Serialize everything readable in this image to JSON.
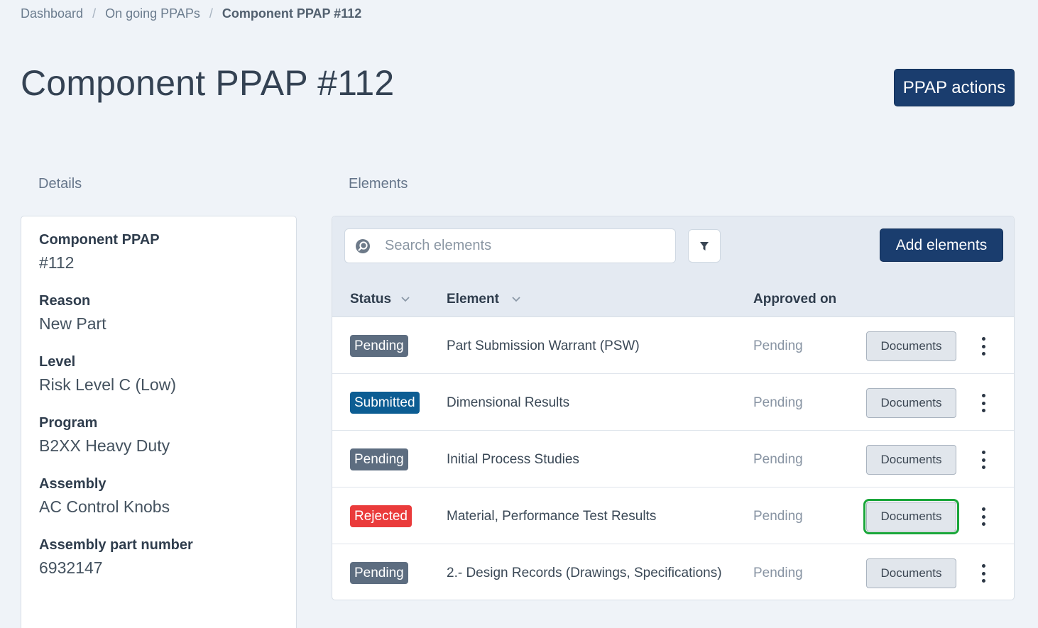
{
  "breadcrumb": {
    "items": [
      "Dashboard",
      "On going PPAPs"
    ],
    "separator": "/",
    "current": "Component PPAP #112"
  },
  "page_title": "Component PPAP #112",
  "actions": {
    "ppap_actions_label": "PPAP actions"
  },
  "details": {
    "heading": "Details",
    "fields": [
      {
        "label": "Component PPAP",
        "value": "#112"
      },
      {
        "label": "Reason",
        "value": "New Part"
      },
      {
        "label": "Level",
        "value": "Risk Level C (Low)"
      },
      {
        "label": "Program",
        "value": "B2XX Heavy Duty"
      },
      {
        "label": "Assembly",
        "value": "AC Control Knobs"
      },
      {
        "label": "Assembly part number",
        "value": "6932147"
      }
    ]
  },
  "elements": {
    "heading": "Elements",
    "search_placeholder": "Search elements",
    "add_label": "Add elements",
    "columns": {
      "status": "Status",
      "element": "Element",
      "approved_on": "Approved on"
    },
    "rows": [
      {
        "status": "Pending",
        "status_kind": "pending",
        "name": "Part Submission Warrant (PSW)",
        "approved_on": "Pending",
        "docs_label": "Documents",
        "highlighted": false
      },
      {
        "status": "Submitted",
        "status_kind": "submitted",
        "name": "Dimensional Results",
        "approved_on": "Pending",
        "docs_label": "Documents",
        "highlighted": false
      },
      {
        "status": "Pending",
        "status_kind": "pending",
        "name": "Initial Process Studies",
        "approved_on": "Pending",
        "docs_label": "Documents",
        "highlighted": false
      },
      {
        "status": "Rejected",
        "status_kind": "rejected",
        "name": "Material, Performance Test Results",
        "approved_on": "Pending",
        "docs_label": "Documents",
        "highlighted": true
      },
      {
        "status": "Pending",
        "status_kind": "pending",
        "name": "2.- Design Records (Drawings, Specifications)",
        "approved_on": "Pending",
        "docs_label": "Documents",
        "highlighted": false
      }
    ]
  },
  "colors": {
    "primary": "#1a3d6e",
    "pending_badge": "#5d6d80",
    "submitted_badge": "#0c5d93",
    "rejected_badge": "#ea3b3b",
    "highlight_outline": "#1aa63a"
  }
}
